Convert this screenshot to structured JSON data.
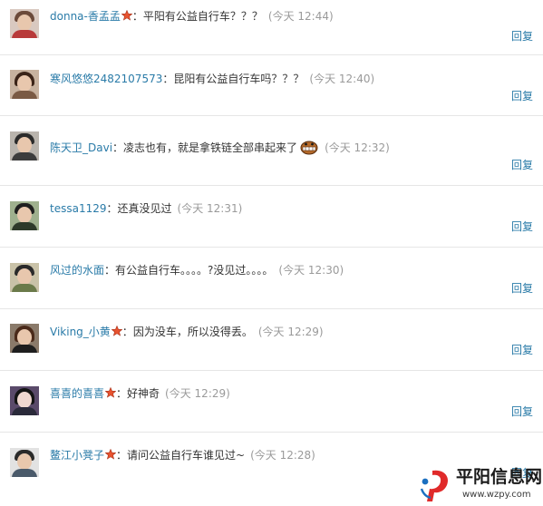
{
  "comments": [
    {
      "user": "donna-香孟孟",
      "badge": true,
      "message": "平阳有公益自行车？？？",
      "emoji": false,
      "time": "(今天 12:44)",
      "reply": "回复"
    },
    {
      "user": "寒风悠悠2482107573",
      "badge": false,
      "message": "昆阳有公益自行车吗？？？",
      "emoji": false,
      "time": "(今天 12:40)",
      "reply": "回复"
    },
    {
      "user": "陈天卫_Davi",
      "badge": false,
      "message": "凌志也有，就是拿铁链全部串起来了",
      "emoji": true,
      "time": "(今天 12:32)",
      "reply": "回复"
    },
    {
      "user": "tessa1129",
      "badge": false,
      "message": "还真没见过",
      "emoji": false,
      "time": "(今天 12:31)",
      "reply": "回复"
    },
    {
      "user": "风过的水面",
      "badge": false,
      "message": "有公益自行车。。。。?没见过。。。。",
      "emoji": false,
      "time": "(今天 12:30)",
      "reply": "回复"
    },
    {
      "user": "Viking_小黄",
      "badge": true,
      "message": "因为没车，所以没得丢。",
      "emoji": false,
      "time": "(今天 12:29)",
      "reply": "回复"
    },
    {
      "user": "喜喜的喜喜",
      "badge": true,
      "message": "好神奇",
      "emoji": false,
      "time": "(今天 12:29)",
      "reply": "回复"
    },
    {
      "user": "鳌江小凳子",
      "badge": true,
      "message": "请问公益自行车谁见过~",
      "emoji": false,
      "time": "(今天 12:28)",
      "reply": "回复"
    }
  ],
  "watermark": {
    "brand": "平阳信息网",
    "url": "www.wzpy.com"
  },
  "colors": {
    "username": "#2a7ba8",
    "time": "#9a9a9a",
    "reply": "#2a7ba8",
    "badge": "#e8532f",
    "divider": "#e6e6e6",
    "logo_red": "#e02a2a"
  }
}
